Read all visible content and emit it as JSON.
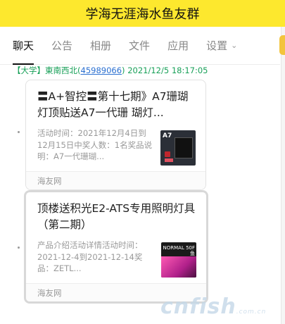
{
  "window": {
    "title": "学海无涯海水鱼友群"
  },
  "tabs": [
    {
      "label": "聊天"
    },
    {
      "label": "公告"
    },
    {
      "label": "相册"
    },
    {
      "label": "文件"
    },
    {
      "label": "应用"
    },
    {
      "label": "设置"
    }
  ],
  "message": {
    "tag": "【大学】",
    "name": "東南西北",
    "qq_open": "(",
    "qq": "45989066",
    "qq_close": ")",
    "datetime": "2021/12/5 18:17:05"
  },
  "cards": [
    {
      "title": "〓A+智控〓第十七期》A7珊瑚灯顶贴送A7一代珊 瑚灯...",
      "desc": "活动时间：2021年12月4日到12月15日中奖人数：1名奖品说明：A7一代珊瑚...",
      "thumb_label": "A7",
      "source": "海友网"
    },
    {
      "title": "顶楼送积光E2-ATS专用照明灯具（第二期）",
      "desc": "产品介绍活动详情活动时间：2021-12-4到2021-12-14奖品：ZETL...",
      "thumb_label": "NORMAL 50F 鱼",
      "source": "海友网"
    }
  ],
  "watermark": {
    "text": "cnfish",
    "suffix": ".com.cn"
  },
  "colors": {
    "titlebar": "#fde82e",
    "sender": "#18a058",
    "link": "#2a6fd0"
  }
}
